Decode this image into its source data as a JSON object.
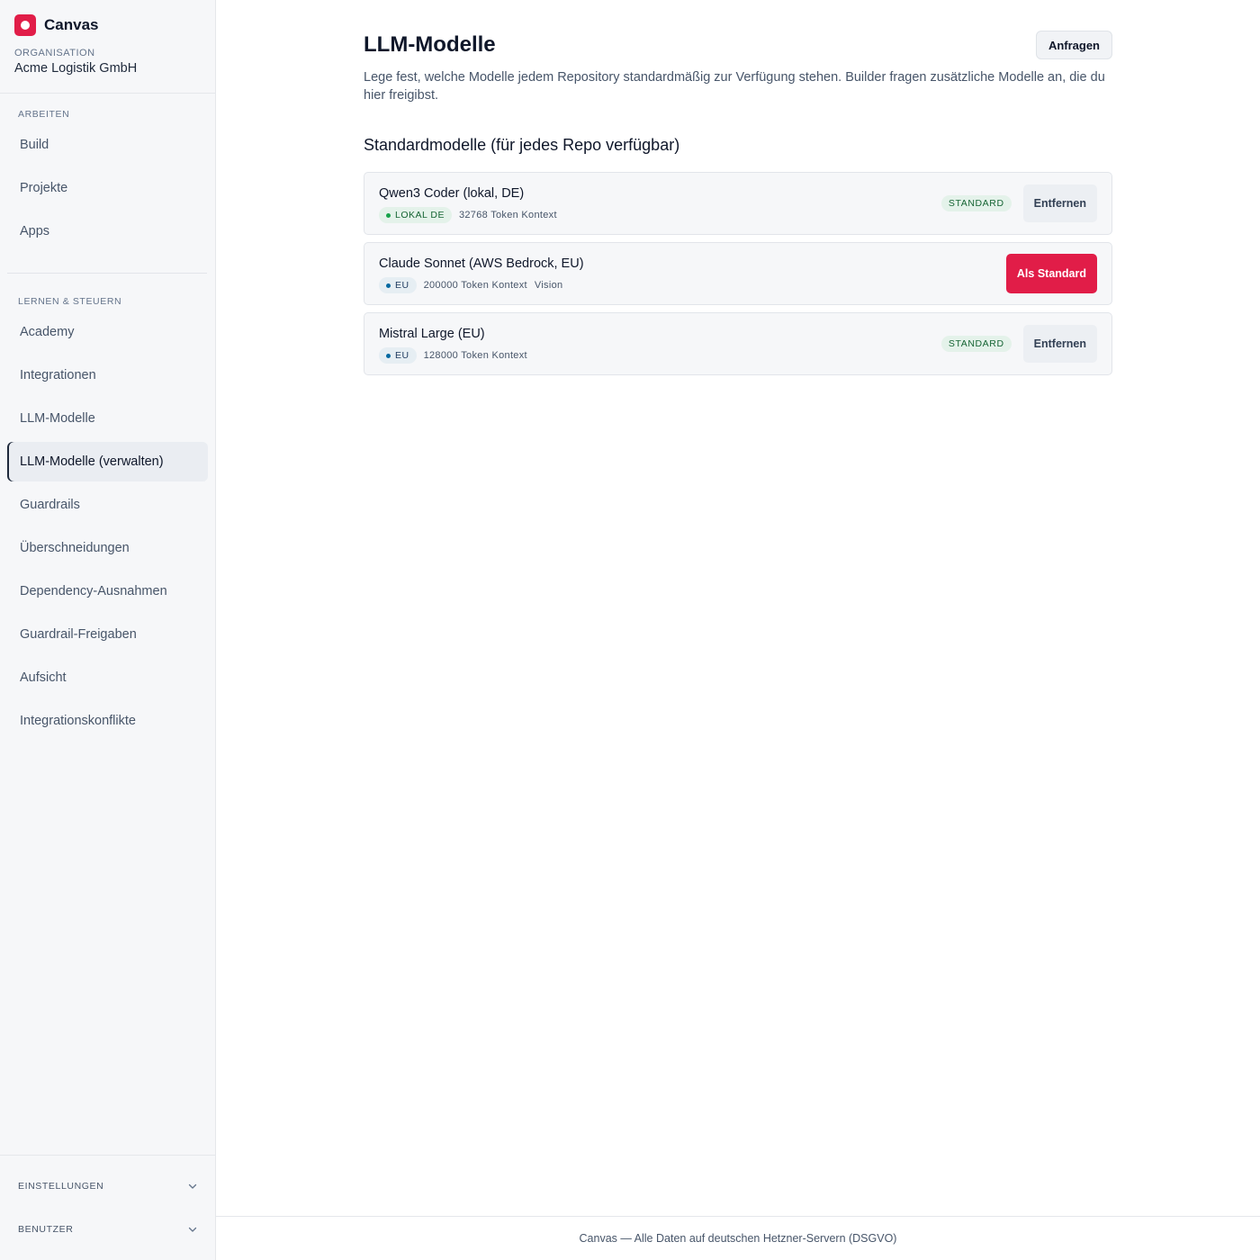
{
  "sidebar": {
    "brand": {
      "name": "Canvas"
    },
    "organization": {
      "label": "ORGANISATION",
      "name": "Acme Logistik GmbH"
    },
    "sections": [
      {
        "label": "ARBEITEN",
        "items": [
          "Build",
          "Projekte",
          "Apps"
        ]
      },
      {
        "label": "LERNEN & STEUERN",
        "items": [
          "Academy",
          "Integrationen",
          "LLM-Modelle",
          "LLM-Modelle (verwalten)",
          "Guardrails",
          "Überschneidungen",
          "Dependency-Ausnahmen",
          "Guardrail-Freigaben",
          "Aufsicht",
          "Integrationskonflikte"
        ]
      }
    ],
    "active_item": "LLM-Modelle (verwalten)",
    "collapsibles": [
      {
        "label": "EINSTELLUNGEN",
        "icon": "chevron-down-icon"
      },
      {
        "label": "BENUTZER",
        "icon": "chevron-down-icon"
      }
    ]
  },
  "main": {
    "title": "LLM-Modelle",
    "request_button": "Anfragen",
    "description": "Lege fest, welche Modelle jedem Repository standardmäßig zur Verfügung stehen. Builder fragen zusätzliche Modelle an, die du hier freigibst.",
    "section_title": "Standardmodelle (für jedes Repo verfügbar)",
    "models": [
      {
        "name": "Qwen3 Coder (lokal, DE)",
        "region": "LOKAL DE",
        "context": "32768 Token Kontext",
        "extra": "",
        "standard_badge": "STANDARD",
        "action": "Entfernen"
      },
      {
        "name": "Claude Sonnet (AWS Bedrock, EU)",
        "region": "EU",
        "context": "200000 Token Kontext",
        "extra": "Vision",
        "standard_badge": "",
        "action": "Als Standard"
      },
      {
        "name": "Mistral Large (EU)",
        "region": "EU",
        "context": "128000 Token Kontext",
        "extra": "",
        "standard_badge": "STANDARD",
        "action": "Entfernen"
      }
    ]
  },
  "footer": {
    "text": "Canvas — Alle Daten auf deutschen Hetzner-Servern (DSGVO)"
  },
  "colors": {
    "accent": "#e11d48",
    "success": "#166534",
    "sidebar_bg": "#f6f7f9"
  }
}
